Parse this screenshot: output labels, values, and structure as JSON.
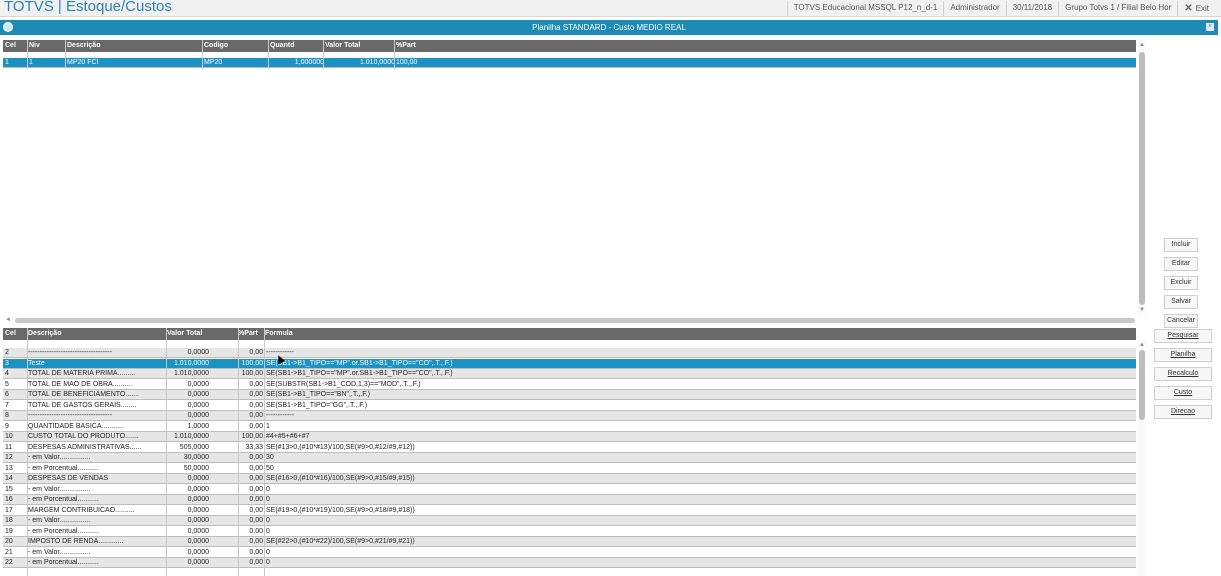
{
  "app": {
    "title": "TOTVS | Estoque/Custos",
    "environment": "TOTVS Educacional MSSQL P12_n_d-1",
    "user": "Administrador",
    "date": "30/11/2018",
    "company": "Grupo Totvs 1 / Filial Belo Hor",
    "exit_label": "Exit"
  },
  "dialog": {
    "title": "Planilha STANDARD - Custo MEDIO REAL"
  },
  "structure_grid": {
    "columns": [
      "Cel",
      "Niv",
      "Descrição",
      "Codigo",
      "Quantd",
      "Valor Total",
      "%Part"
    ],
    "rows": [
      {
        "cel": "1",
        "niv": "1",
        "descricao": "MP20 FCI",
        "codigo": "MP20",
        "quantd": "1,000000",
        "valor_total": "1.010,0000",
        "part": "100,00"
      }
    ]
  },
  "formula_grid": {
    "columns": [
      "Cel",
      "Descrição",
      "Valor Total",
      "%Part",
      "Formula"
    ],
    "rows": [
      {
        "cel": "2",
        "descricao": "------------------------------------",
        "valor": "0,0000",
        "part": "0,00",
        "formula": "------------"
      },
      {
        "cel": "3",
        "descricao": "Teste",
        "valor": "1.010,0000",
        "part": "100,00",
        "formula": "SE(SB1->B1_TIPO==\"MP\".or.SB1->B1_TIPO==\"CO\",.T.,.F.)"
      },
      {
        "cel": "4",
        "descricao": "TOTAL DE MATERIA PRIMA.........",
        "valor": "1.010,0000",
        "part": "100,00",
        "formula": "SE(SB1->B1_TIPO==\"MP\".or.SB1->B1_TIPO==\"CO\",.T.,.F.)"
      },
      {
        "cel": "5",
        "descricao": "TOTAL DE MAO DE OBRA..........",
        "valor": "0,0000",
        "part": "0,00",
        "formula": "SE(SUBSTR(SB1->B1_COD,1,3)==\"MOD\",.T.,.F.)"
      },
      {
        "cel": "6",
        "descricao": "TOTAL DE BENEFICIAMENTO.......",
        "valor": "0,0000",
        "part": "0,00",
        "formula": "SE(SB1->B1_TIPO==\"BN\",.T.,.F.)"
      },
      {
        "cel": "7",
        "descricao": "TOTAL DE GASTOS GERAIS........",
        "valor": "0,0000",
        "part": "0,00",
        "formula": "SE(SB1->B1_TIPO=\"GG\",.T.,.F.)"
      },
      {
        "cel": "8",
        "descricao": "------------------------------------",
        "valor": "0,0000",
        "part": "0,00",
        "formula": "------------"
      },
      {
        "cel": "9",
        "descricao": "QUANTIDADE BASICA............",
        "valor": "1,0000",
        "part": "0,00",
        "formula": "1"
      },
      {
        "cel": "10",
        "descricao": "CUSTO TOTAL DO PRODUTO.......",
        "valor": "1.010,0000",
        "part": "100,00",
        "formula": "#4+#5+#6+#7"
      },
      {
        "cel": "11",
        "descricao": "DESPESAS ADMINISTRATIVAS......",
        "valor": "505,0000",
        "part": "33,33",
        "formula": "SE(#13>0,(#10*#13)/100,SE(#9>0,#12/#9,#12))"
      },
      {
        "cel": "12",
        "descricao": "   - em Valor................",
        "valor": "30,0000",
        "part": "0,00",
        "formula": "30"
      },
      {
        "cel": "13",
        "descricao": "   - em Porcentual...........",
        "valor": "50,0000",
        "part": "0,00",
        "formula": "50"
      },
      {
        "cel": "14",
        "descricao": "DESPESAS DE VENDAS",
        "valor": "0,0000",
        "part": "0,00",
        "formula": "SE(#16>0,(#10*#16)/100,SE(#9>0,#15/#9,#15))"
      },
      {
        "cel": "15",
        "descricao": "   - em Valor................",
        "valor": "0,0000",
        "part": "0,00",
        "formula": "0"
      },
      {
        "cel": "16",
        "descricao": "   - em Porcentual...........",
        "valor": "0,0000",
        "part": "0,00",
        "formula": "0"
      },
      {
        "cel": "17",
        "descricao": "MARGEM CONTRIBUICAO..........",
        "valor": "0,0000",
        "part": "0,00",
        "formula": "SE(#19>0,(#10*#19)/100,SE(#9>0,#18/#9,#18))"
      },
      {
        "cel": "18",
        "descricao": "   - em Valor................",
        "valor": "0,0000",
        "part": "0,00",
        "formula": "0"
      },
      {
        "cel": "19",
        "descricao": "   - em Porcentual...........",
        "valor": "0,0000",
        "part": "0,00",
        "formula": "0"
      },
      {
        "cel": "20",
        "descricao": "IMPOSTO DE RENDA.............",
        "valor": "0,0000",
        "part": "0,00",
        "formula": "SE(#22>0,(#10*#22)/100,SE(#9>0,#21/#9,#21))"
      },
      {
        "cel": "21",
        "descricao": "   - em Valor................",
        "valor": "0,0000",
        "part": "0,00",
        "formula": "0"
      },
      {
        "cel": "22",
        "descricao": "   - em Porcentual...........",
        "valor": "0,0000",
        "part": "0,00",
        "formula": "0"
      }
    ]
  },
  "buttons": {
    "incluir": "Incluir",
    "editar": "Editar",
    "excluir": "Excluir",
    "salvar": "Salvar",
    "cancelar": "Cancelar",
    "pesquisar": "Pesquisar",
    "planilha": "Planilha",
    "recalculo": "Recalculo",
    "custo": "Custo",
    "direcao": "Direcao"
  }
}
